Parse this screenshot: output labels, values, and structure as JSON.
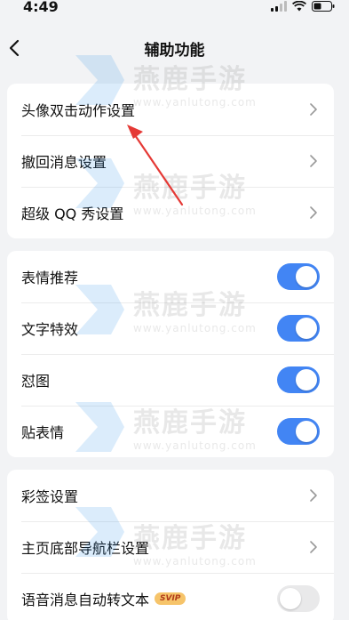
{
  "status_bar": {
    "time": "4:49"
  },
  "nav": {
    "title": "辅助功能"
  },
  "groups": [
    {
      "rows": [
        {
          "label": "头像双击动作设置"
        },
        {
          "label": "撤回消息设置"
        },
        {
          "label": "超级 QQ 秀设置"
        }
      ]
    },
    {
      "rows": [
        {
          "label": "表情推荐",
          "enabled": true
        },
        {
          "label": "文字特效",
          "enabled": true
        },
        {
          "label": "怼图",
          "enabled": true
        },
        {
          "label": "贴表情",
          "enabled": true
        }
      ]
    },
    {
      "rows": [
        {
          "label": "彩签设置"
        },
        {
          "label": "主页底部导航栏设置"
        },
        {
          "label": "语音消息自动转文本",
          "badge": "SVIP",
          "enabled": false
        }
      ]
    }
  ],
  "watermark": {
    "brand": "燕鹿手游",
    "url": "www.yanlutong.com"
  },
  "colors": {
    "toggle_on": "#4285f4",
    "toggle_off": "#e9e9ea",
    "background": "#f2f3f5",
    "arrow": "#e53935"
  }
}
